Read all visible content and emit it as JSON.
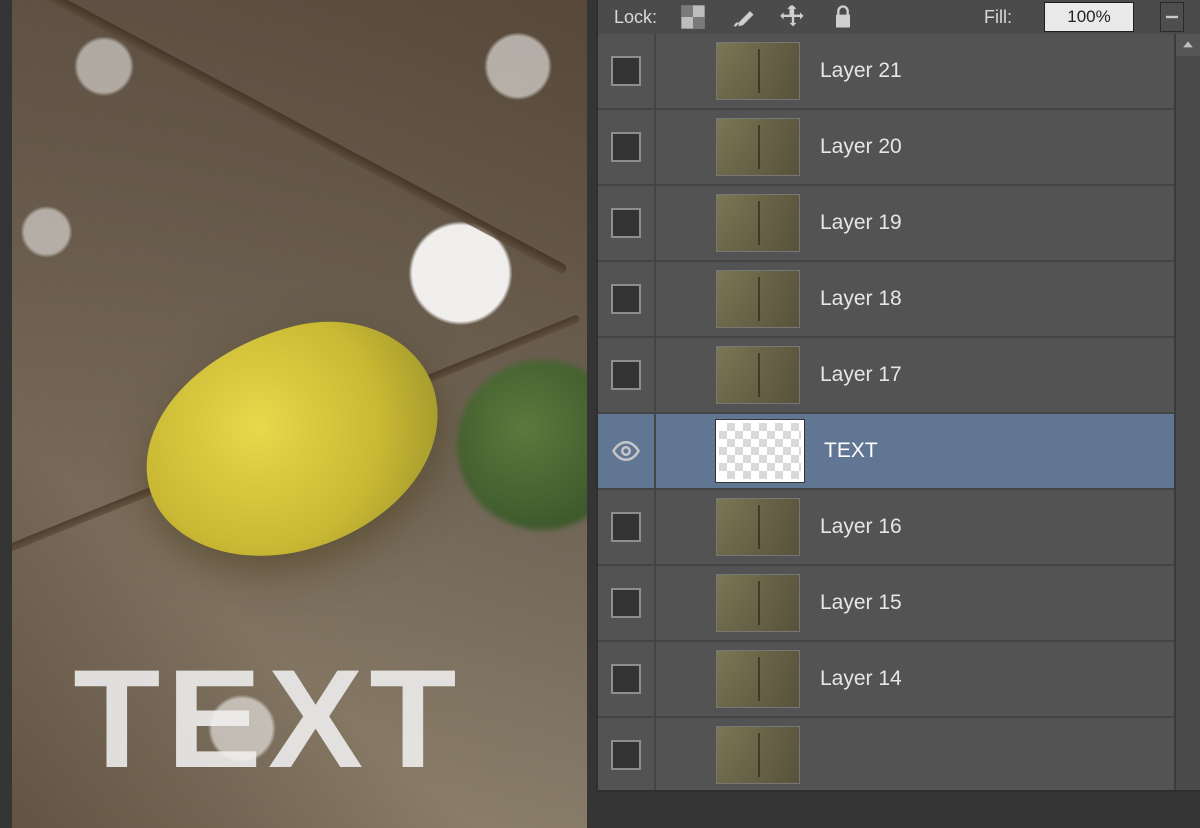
{
  "lockbar": {
    "label": "Lock:",
    "fill_label": "Fill:",
    "fill_value": "100%",
    "icons": [
      "checker-lock-icon",
      "brush-icon",
      "move-icon",
      "padlock-icon"
    ]
  },
  "canvas": {
    "text": "TEXT"
  },
  "layers": [
    {
      "name": "Layer 21",
      "visible": false,
      "selected": false,
      "thumb": "image"
    },
    {
      "name": "Layer 20",
      "visible": false,
      "selected": false,
      "thumb": "image"
    },
    {
      "name": "Layer 19",
      "visible": false,
      "selected": false,
      "thumb": "image"
    },
    {
      "name": "Layer 18",
      "visible": false,
      "selected": false,
      "thumb": "image"
    },
    {
      "name": "Layer 17",
      "visible": false,
      "selected": false,
      "thumb": "image"
    },
    {
      "name": "TEXT",
      "visible": true,
      "selected": true,
      "thumb": "text"
    },
    {
      "name": "Layer 16",
      "visible": false,
      "selected": false,
      "thumb": "image"
    },
    {
      "name": "Layer 15",
      "visible": false,
      "selected": false,
      "thumb": "image"
    },
    {
      "name": "Layer 14",
      "visible": false,
      "selected": false,
      "thumb": "image"
    },
    {
      "name": "",
      "visible": false,
      "selected": false,
      "thumb": "image"
    }
  ]
}
